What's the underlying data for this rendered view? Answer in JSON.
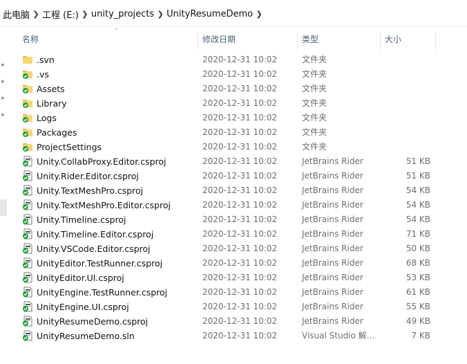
{
  "breadcrumb": [
    "此电脑",
    "工程 (E:)",
    "unity_projects",
    "UnityResumeDemo"
  ],
  "columns": {
    "name": "名称",
    "modified": "修改日期",
    "type": "类型",
    "size": "大小"
  },
  "files": [
    {
      "name": ".svn",
      "modified": "2020-12-31 10:02",
      "type": "文件夹",
      "size": "",
      "icon": "folder-icon"
    },
    {
      "name": ".vs",
      "modified": "2020-12-31 10:02",
      "type": "文件夹",
      "size": "",
      "icon": "folder-synced-icon"
    },
    {
      "name": "Assets",
      "modified": "2020-12-31 10:02",
      "type": "文件夹",
      "size": "",
      "icon": "folder-synced-icon"
    },
    {
      "name": "Library",
      "modified": "2020-12-31 10:02",
      "type": "文件夹",
      "size": "",
      "icon": "folder-synced-icon"
    },
    {
      "name": "Logs",
      "modified": "2020-12-31 10:02",
      "type": "文件夹",
      "size": "",
      "icon": "folder-synced-icon"
    },
    {
      "name": "Packages",
      "modified": "2020-12-31 10:02",
      "type": "文件夹",
      "size": "",
      "icon": "folder-synced-icon"
    },
    {
      "name": "ProjectSettings",
      "modified": "2020-12-31 10:02",
      "type": "文件夹",
      "size": "",
      "icon": "folder-synced-icon"
    },
    {
      "name": "Unity.CollabProxy.Editor.csproj",
      "modified": "2020-12-31 10:02",
      "type": "JetBrains Rider",
      "size": "51 KB",
      "icon": "csproj-file-synced-icon"
    },
    {
      "name": "Unity.Rider.Editor.csproj",
      "modified": "2020-12-31 10:02",
      "type": "JetBrains Rider",
      "size": "51 KB",
      "icon": "csproj-file-synced-icon"
    },
    {
      "name": "Unity.TextMeshPro.csproj",
      "modified": "2020-12-31 10:02",
      "type": "JetBrains Rider",
      "size": "54 KB",
      "icon": "csproj-file-synced-icon"
    },
    {
      "name": "Unity.TextMeshPro.Editor.csproj",
      "modified": "2020-12-31 10:02",
      "type": "JetBrains Rider",
      "size": "54 KB",
      "icon": "csproj-file-synced-icon"
    },
    {
      "name": "Unity.Timeline.csproj",
      "modified": "2020-12-31 10:02",
      "type": "JetBrains Rider",
      "size": "54 KB",
      "icon": "csproj-file-synced-icon"
    },
    {
      "name": "Unity.Timeline.Editor.csproj",
      "modified": "2020-12-31 10:02",
      "type": "JetBrains Rider",
      "size": "71 KB",
      "icon": "csproj-file-synced-icon"
    },
    {
      "name": "Unity.VSCode.Editor.csproj",
      "modified": "2020-12-31 10:02",
      "type": "JetBrains Rider",
      "size": "50 KB",
      "icon": "csproj-file-synced-icon"
    },
    {
      "name": "UnityEditor.TestRunner.csproj",
      "modified": "2020-12-31 10:02",
      "type": "JetBrains Rider",
      "size": "68 KB",
      "icon": "csproj-file-synced-icon"
    },
    {
      "name": "UnityEditor.UI.csproj",
      "modified": "2020-12-31 10:02",
      "type": "JetBrains Rider",
      "size": "53 KB",
      "icon": "csproj-file-synced-icon"
    },
    {
      "name": "UnityEngine.TestRunner.csproj",
      "modified": "2020-12-31 10:02",
      "type": "JetBrains Rider",
      "size": "61 KB",
      "icon": "csproj-file-synced-icon"
    },
    {
      "name": "UnityEngine.UI.csproj",
      "modified": "2020-12-31 10:02",
      "type": "JetBrains Rider",
      "size": "55 KB",
      "icon": "csproj-file-synced-icon"
    },
    {
      "name": "UnityResumeDemo.csproj",
      "modified": "2020-12-31 10:02",
      "type": "JetBrains Rider",
      "size": "49 KB",
      "icon": "csproj-file-synced-icon"
    },
    {
      "name": "UnityResumeDemo.sln",
      "modified": "2020-12-31 10:02",
      "type": "Visual Studio 解...",
      "size": "7 KB",
      "icon": "sln-file-synced-icon"
    }
  ],
  "colors": {
    "folder": "#f8d775",
    "folder_dark": "#e8b84a",
    "sync_green": "#1e9e3a",
    "header_text": "#4c607a",
    "meta_text": "#6d6d6d"
  }
}
